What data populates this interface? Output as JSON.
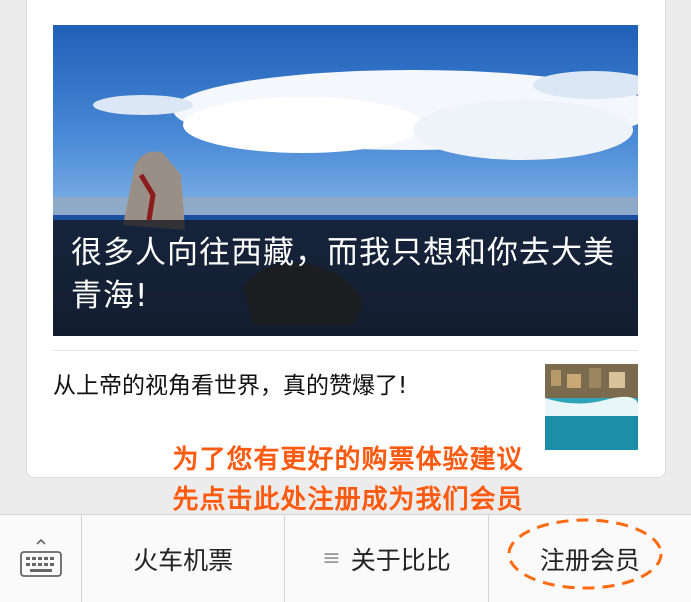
{
  "article": {
    "hero_caption": "很多人向往西藏，而我只想和你去大美青海!",
    "second_title": "从上帝的视角看世界，真的赞爆了!"
  },
  "overlay_note": {
    "line1": "为了您有更好的购票体验建议",
    "line2": "先点击此处注册成为我们会员",
    "color": "#ff5a10"
  },
  "menu": {
    "keyboard_icon": "keyboard-icon",
    "items": [
      {
        "label": "火车机票"
      },
      {
        "label": "关于比比",
        "icon": "submenu-icon"
      },
      {
        "label": "注册会员"
      }
    ]
  }
}
